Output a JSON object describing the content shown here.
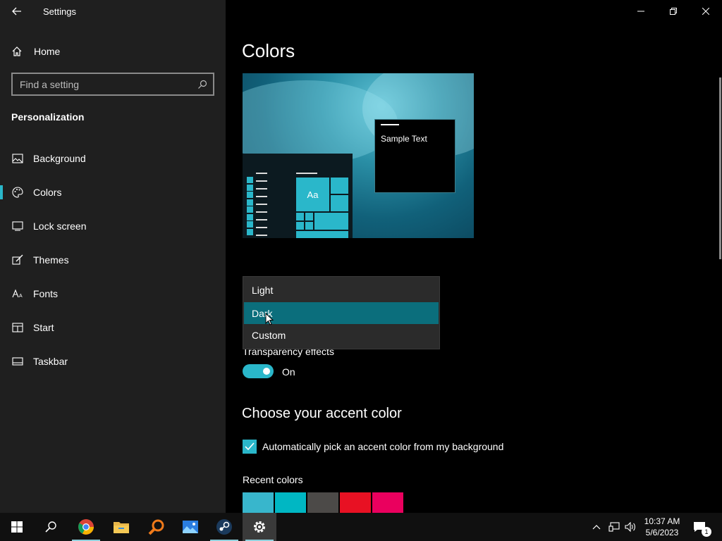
{
  "window": {
    "title": "Settings"
  },
  "sidebar": {
    "home_label": "Home",
    "search_placeholder": "Find a setting",
    "section": "Personalization",
    "items": [
      {
        "label": "Background",
        "icon": "image-icon"
      },
      {
        "label": "Colors",
        "icon": "palette-icon",
        "active": true
      },
      {
        "label": "Lock screen",
        "icon": "lock-screen-icon"
      },
      {
        "label": "Themes",
        "icon": "brush-icon"
      },
      {
        "label": "Fonts",
        "icon": "font-icon"
      },
      {
        "label": "Start",
        "icon": "start-layout-icon"
      },
      {
        "label": "Taskbar",
        "icon": "taskbar-icon"
      }
    ]
  },
  "main": {
    "title": "Colors",
    "preview": {
      "sample_text": "Sample Text",
      "tile_text": "Aa"
    },
    "mode_dropdown": {
      "options": [
        "Light",
        "Dark",
        "Custom"
      ],
      "selected": "Dark"
    },
    "transparency": {
      "label": "Transparency effects",
      "state": "On"
    },
    "accent_heading": "Choose your accent color",
    "auto_accent_label": "Automatically pick an accent color from my background",
    "recent_colors_label": "Recent colors",
    "recent_colors": [
      "#38b6cc",
      "#00b7c3",
      "#4c4a48",
      "#e81123",
      "#ea005e"
    ]
  },
  "taskbar": {
    "apps": [
      "start-icon",
      "search-icon",
      "chrome-icon",
      "file-explorer-icon",
      "magnifier-app-icon",
      "photos-icon",
      "steam-icon",
      "settings-gear-icon"
    ],
    "time": "10:37 AM",
    "date": "5/6/2023",
    "notification_count": "1"
  },
  "colors": {
    "accent": "#2ab7ca",
    "sidebar_bg": "#1f1f1f",
    "dropdown_selected": "#0b6e7c"
  }
}
